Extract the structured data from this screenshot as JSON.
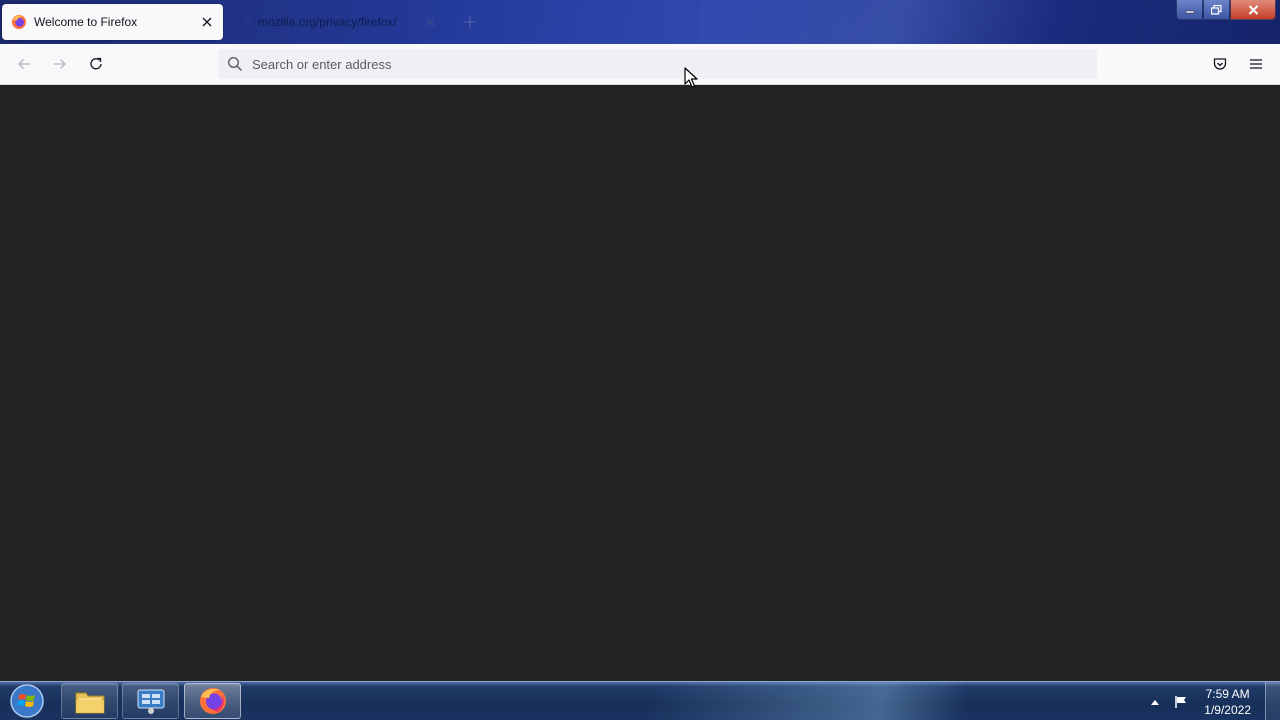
{
  "browser": {
    "tabs": [
      {
        "title": "Welcome to Firefox",
        "active": true
      },
      {
        "title": "mozilla.org/privacy/firefox/",
        "active": false
      }
    ],
    "urlbar": {
      "placeholder": "Search or enter address",
      "value": ""
    },
    "icons": {
      "back": "arrow-left-icon",
      "forward": "arrow-right-icon",
      "reload": "reload-icon",
      "search": "search-icon",
      "pocket": "pocket-icon",
      "menu": "hamburger-menu-icon",
      "new_tab": "plus-icon"
    },
    "content_background": "#232323"
  },
  "taskbar": {
    "apps": [
      "start-button",
      "file-explorer",
      "control-panel",
      "firefox"
    ],
    "clock": {
      "time": "7:59 AM",
      "date": "1/9/2022"
    }
  },
  "colors": {
    "toolbar_bg": "#f9f9fb",
    "urlbar_bg": "#f0f0f4",
    "content_bg": "#232323"
  }
}
